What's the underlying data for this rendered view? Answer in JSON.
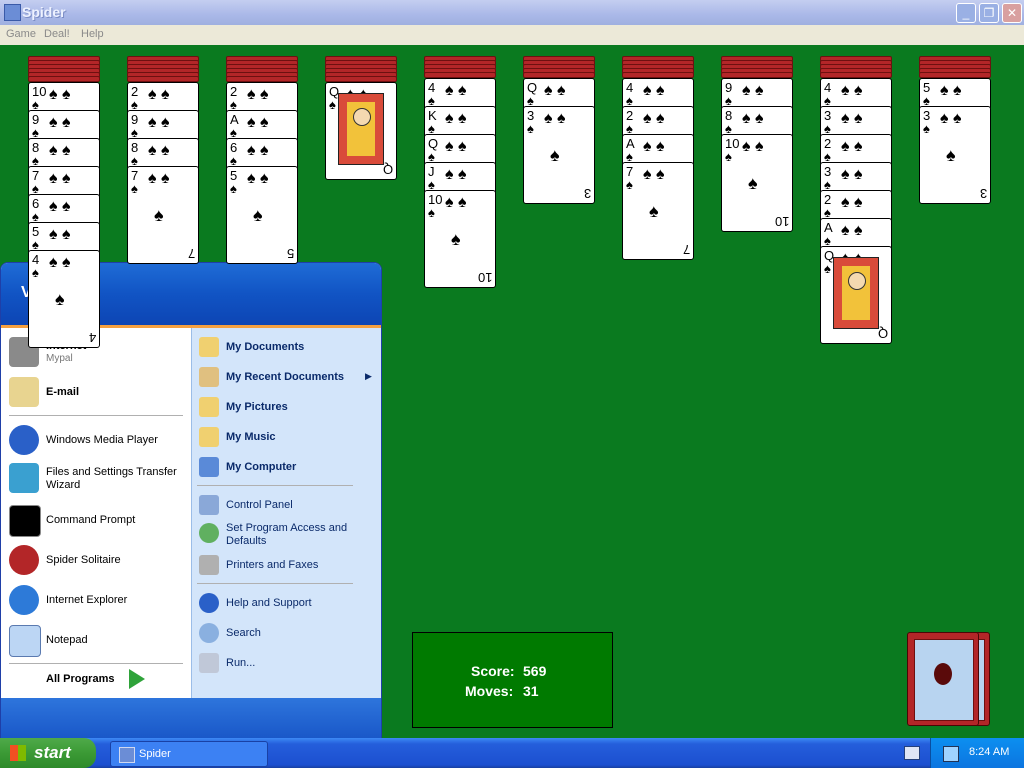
{
  "window": {
    "title": "Spider"
  },
  "menubar": {
    "items": [
      "Game",
      "Deal!",
      "Help"
    ]
  },
  "board": {
    "columns": [
      {
        "backs": 6,
        "cards": [
          "10",
          "9",
          "8",
          "7",
          "6",
          "5",
          "4"
        ]
      },
      {
        "backs": 6,
        "cards": [
          "2",
          "9",
          "8",
          "7"
        ]
      },
      {
        "backs": 6,
        "cards": [
          "2",
          "A",
          "6",
          "5"
        ]
      },
      {
        "backs": 6,
        "cards": [
          "Q"
        ]
      },
      {
        "backs": 5,
        "cards": [
          "4",
          "K",
          "Q",
          "J",
          "10"
        ]
      },
      {
        "backs": 5,
        "cards": [
          "Q",
          "3"
        ]
      },
      {
        "backs": 5,
        "cards": [
          "4",
          "2",
          "A",
          "7"
        ]
      },
      {
        "backs": 5,
        "cards": [
          "9",
          "8",
          "10"
        ]
      },
      {
        "backs": 5,
        "cards": [
          "4",
          "3",
          "2",
          "3",
          "2",
          "A",
          "Q"
        ]
      },
      {
        "backs": 5,
        "cards": [
          "5",
          "3"
        ]
      }
    ]
  },
  "score": {
    "score_label": "Score:",
    "score_value": "569",
    "moves_label": "Moves:",
    "moves_value": "31"
  },
  "start_menu": {
    "user": "VM2",
    "left_items": [
      {
        "title": "Internet",
        "subtitle": "Mypal",
        "bold": true,
        "icon": "raccoon-icon"
      },
      {
        "title": "E-mail",
        "subtitle": "",
        "bold": true,
        "icon": "email-icon"
      },
      {
        "title": "Windows Media Player",
        "subtitle": "",
        "bold": false,
        "icon": "media-player-icon"
      },
      {
        "title": "Files and Settings Transfer",
        "subtitle": "Wizard",
        "bold": false,
        "icon": "transfer-wizard-icon"
      },
      {
        "title": "Command Prompt",
        "subtitle": "",
        "bold": false,
        "icon": "command-prompt-icon"
      },
      {
        "title": "Spider Solitaire",
        "subtitle": "",
        "bold": false,
        "icon": "spider-icon"
      },
      {
        "title": "Internet Explorer",
        "subtitle": "",
        "bold": false,
        "icon": "ie-icon"
      },
      {
        "title": "Notepad",
        "subtitle": "",
        "bold": false,
        "icon": "notepad-icon"
      }
    ],
    "all_programs": "All Programs",
    "right_items": [
      {
        "label": "My Documents",
        "bold": true,
        "icon": "folder-icon"
      },
      {
        "label": "My Recent Documents",
        "bold": true,
        "icon": "recent-icon",
        "arrow": "▶"
      },
      {
        "label": "My Pictures",
        "bold": true,
        "icon": "pictures-icon"
      },
      {
        "label": "My Music",
        "bold": true,
        "icon": "music-icon"
      },
      {
        "label": "My Computer",
        "bold": true,
        "icon": "computer-icon"
      },
      {
        "label": "Control Panel",
        "bold": false,
        "icon": "control-panel-icon"
      },
      {
        "label": "Set Program Access and",
        "label2": "Defaults",
        "bold": false,
        "icon": "program-access-icon"
      },
      {
        "label": "Printers and Faxes",
        "bold": false,
        "icon": "printer-icon"
      },
      {
        "label": "Help and Support",
        "bold": false,
        "icon": "help-icon"
      },
      {
        "label": "Search",
        "bold": false,
        "icon": "search-icon"
      },
      {
        "label": "Run...",
        "bold": false,
        "icon": "run-icon"
      }
    ]
  },
  "taskbar": {
    "start_label": "start",
    "task_label": "Spider",
    "time": "8:24 AM"
  },
  "colors": {
    "felt": "#0a7a1f",
    "card_back": "#b32628",
    "taskbar": "#245edb",
    "start_green": "#3b9a35"
  }
}
